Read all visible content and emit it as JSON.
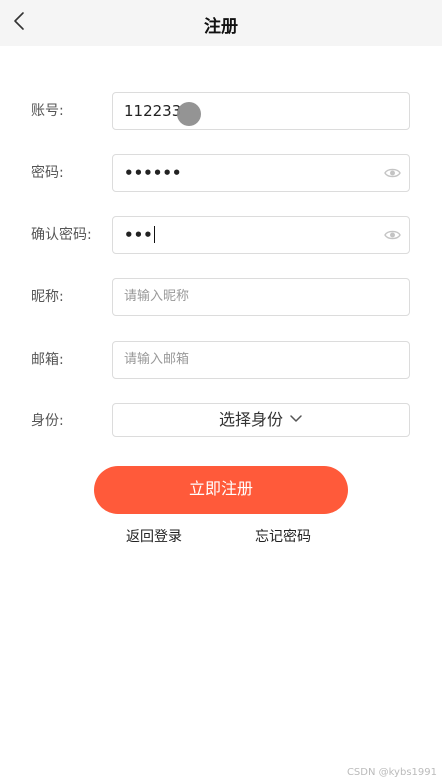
{
  "header": {
    "title": "注册",
    "back_icon": "chevron-left-icon"
  },
  "form": {
    "account": {
      "label": "账号:",
      "value": "112233"
    },
    "password": {
      "label": "密码:",
      "value": "••••••",
      "icon": "eye-icon"
    },
    "confirm_password": {
      "label": "确认密码:",
      "value": "•••",
      "icon": "eye-icon"
    },
    "nickname": {
      "label": "昵称:",
      "placeholder": "请输入昵称"
    },
    "email": {
      "label": "邮箱:",
      "placeholder": "请输入邮箱"
    },
    "identity": {
      "label": "身份:",
      "selected": "选择身份",
      "icon": "chevron-down-icon"
    }
  },
  "actions": {
    "register": "立即注册",
    "back_to_login": "返回登录",
    "forgot_password": "忘记密码"
  },
  "watermark": "CSDN @kybs1991",
  "colors": {
    "accent": "#ff5a3a",
    "nav_bg": "#f5f5f5",
    "border": "#dcdcdc"
  }
}
